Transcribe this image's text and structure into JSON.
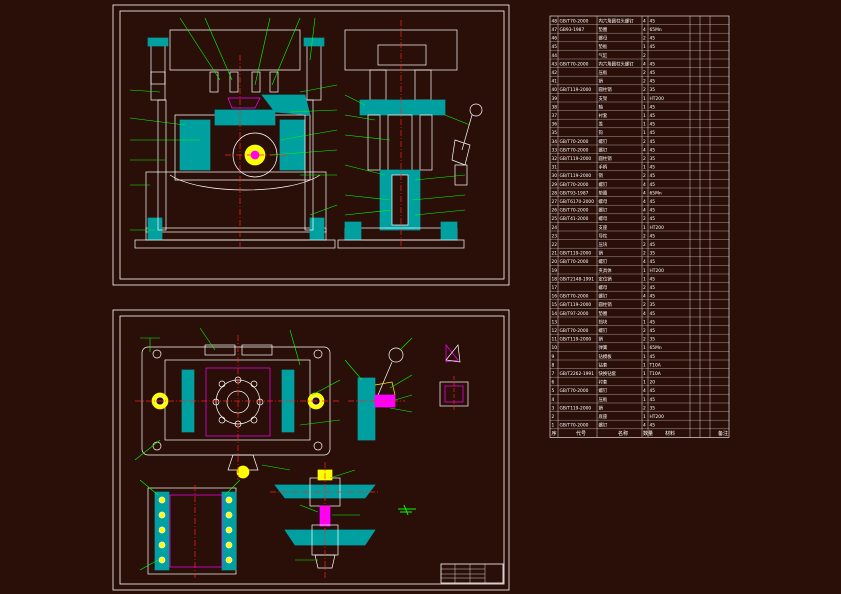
{
  "colors": {
    "background": "#2a0e08",
    "frame": "#ffffff",
    "outline": "#ffffff",
    "leader": "#00ff00",
    "hatch": "#00a0a0",
    "centerline": "#ff2020",
    "magenta": "#ff00ff",
    "yellow": "#ffff00"
  },
  "bom": {
    "header": [
      "序",
      "代号",
      "名称",
      "数量",
      "材料",
      "备注"
    ],
    "rows": [
      [
        "48",
        "GB/T70-2000",
        "内六角圆柱头螺钉",
        "4",
        "45",
        ""
      ],
      [
        "47",
        "GB93-1987",
        "垫圈",
        "4",
        "65Mn",
        ""
      ],
      [
        "46",
        "",
        "螺母",
        "2",
        "45",
        ""
      ],
      [
        "45",
        "",
        "垫板",
        "1",
        "45",
        ""
      ],
      [
        "44",
        "",
        "气缸",
        "2",
        "",
        ""
      ],
      [
        "43",
        "GB/T70-2000",
        "内六角圆柱头螺钉",
        "4",
        "45",
        ""
      ],
      [
        "42",
        "",
        "压板",
        "2",
        "45",
        ""
      ],
      [
        "41",
        "",
        "销",
        "2",
        "45",
        ""
      ],
      [
        "40",
        "GB/T119-2000",
        "圆柱销",
        "2",
        "35",
        ""
      ],
      [
        "39",
        "",
        "支架",
        "1",
        "HT200",
        ""
      ],
      [
        "38",
        "",
        "轴",
        "1",
        "45",
        ""
      ],
      [
        "37",
        "",
        "衬套",
        "1",
        "45",
        ""
      ],
      [
        "36",
        "",
        "盖",
        "1",
        "45",
        ""
      ],
      [
        "35",
        "",
        "钩",
        "1",
        "45",
        ""
      ],
      [
        "34",
        "GB/T70-2000",
        "螺钉",
        "2",
        "45",
        ""
      ],
      [
        "33",
        "GB/T70-2000",
        "螺钉",
        "4",
        "45",
        ""
      ],
      [
        "32",
        "GB/T119-2000",
        "圆柱销",
        "2",
        "35",
        ""
      ],
      [
        "31",
        "",
        "手柄",
        "1",
        "45",
        ""
      ],
      [
        "30",
        "GB/T119-2000",
        "销",
        "2",
        "45",
        ""
      ],
      [
        "29",
        "GB/T70-2000",
        "螺钉",
        "4",
        "45",
        ""
      ],
      [
        "28",
        "GB/T93-1987",
        "垫圈",
        "4",
        "65Mn",
        ""
      ],
      [
        "27",
        "GB/T6170-2000",
        "螺母",
        "4",
        "45",
        ""
      ],
      [
        "26",
        "GB/T70-2000",
        "螺钉",
        "4",
        "45",
        ""
      ],
      [
        "25",
        "GB/T41-2000",
        "螺母",
        "2",
        "45",
        ""
      ],
      [
        "24",
        "",
        "支座",
        "1",
        "HT200",
        ""
      ],
      [
        "23",
        "",
        "导柱",
        "2",
        "45",
        ""
      ],
      [
        "22",
        "",
        "压块",
        "2",
        "45",
        ""
      ],
      [
        "21",
        "GB/T119-2000",
        "销",
        "2",
        "35",
        ""
      ],
      [
        "20",
        "GB/T70-2000",
        "螺钉",
        "4",
        "45",
        ""
      ],
      [
        "19",
        "",
        "夹具体",
        "1",
        "HT200",
        ""
      ],
      [
        "18",
        "GB/T2148-1991",
        "定位销",
        "1",
        "45",
        ""
      ],
      [
        "17",
        "",
        "螺母",
        "2",
        "45",
        ""
      ],
      [
        "16",
        "GB/T70-2000",
        "螺钉",
        "4",
        "45",
        ""
      ],
      [
        "15",
        "GB/T119-2000",
        "圆柱销",
        "2",
        "35",
        ""
      ],
      [
        "14",
        "GB/T97-2000",
        "垫圈",
        "4",
        "45",
        ""
      ],
      [
        "13",
        "",
        "挡块",
        "1",
        "45",
        ""
      ],
      [
        "12",
        "GB/T70-2000",
        "螺钉",
        "2",
        "45",
        ""
      ],
      [
        "11",
        "GB/T119-2000",
        "销",
        "2",
        "35",
        ""
      ],
      [
        "10",
        "",
        "弹簧",
        "1",
        "65Mn",
        ""
      ],
      [
        "9",
        "",
        "钻模板",
        "1",
        "45",
        ""
      ],
      [
        "8",
        "",
        "钻套",
        "1",
        "T10A",
        ""
      ],
      [
        "7",
        "GB/T2262-1991",
        "快换钻套",
        "1",
        "T10A",
        ""
      ],
      [
        "6",
        "",
        "衬套",
        "1",
        "20",
        ""
      ],
      [
        "5",
        "GB/T70-2000",
        "螺钉",
        "4",
        "45",
        ""
      ],
      [
        "4",
        "",
        "压板",
        "1",
        "45",
        ""
      ],
      [
        "3",
        "GB/T119-2000",
        "销",
        "2",
        "35",
        ""
      ],
      [
        "2",
        "",
        "底座",
        "1",
        "HT200",
        ""
      ],
      [
        "1",
        "GB/T70-2000",
        "螺钉",
        "4",
        "45",
        ""
      ]
    ]
  }
}
